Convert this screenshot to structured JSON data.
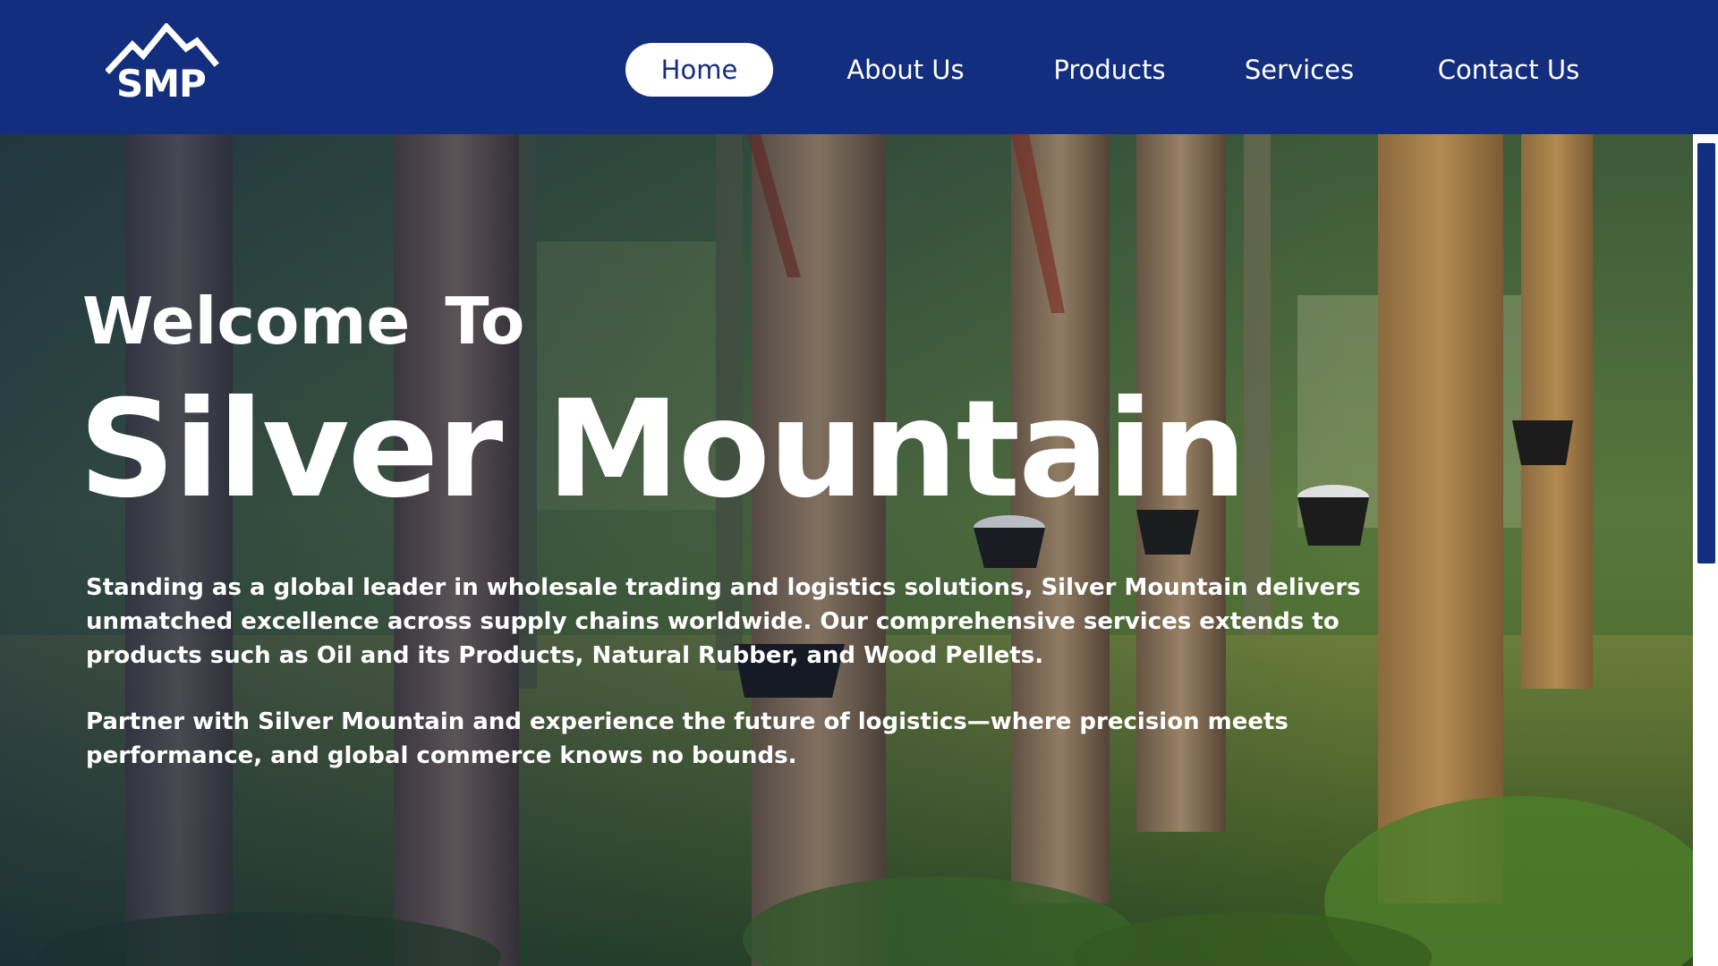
{
  "brand": {
    "logo_text": "SMP",
    "logo_icon": "mountain-peaks-icon",
    "primary_color": "#132e7e",
    "text_color": "#ffffff"
  },
  "nav": {
    "items": [
      {
        "label": "Home",
        "active": true
      },
      {
        "label": "About Us",
        "active": false
      },
      {
        "label": "Products",
        "active": false
      },
      {
        "label": "Services",
        "active": false
      },
      {
        "label": "Contact Us",
        "active": false
      }
    ]
  },
  "hero": {
    "welcome": "Welcome  To",
    "title": "Silver Mountain",
    "paragraph_1": "Standing as a global leader in wholesale trading and logistics solutions, Silver Mountain delivers unmatched excellence across supply chains worldwide. Our comprehensive services extends to products such as Oil and its Products, Natural Rubber, and Wood Pellets.",
    "paragraph_2": "Partner with Silver Mountain and experience the future of logistics—where precision meets performance, and global commerce knows no bounds.",
    "background": "rubber-plantation-photo"
  }
}
